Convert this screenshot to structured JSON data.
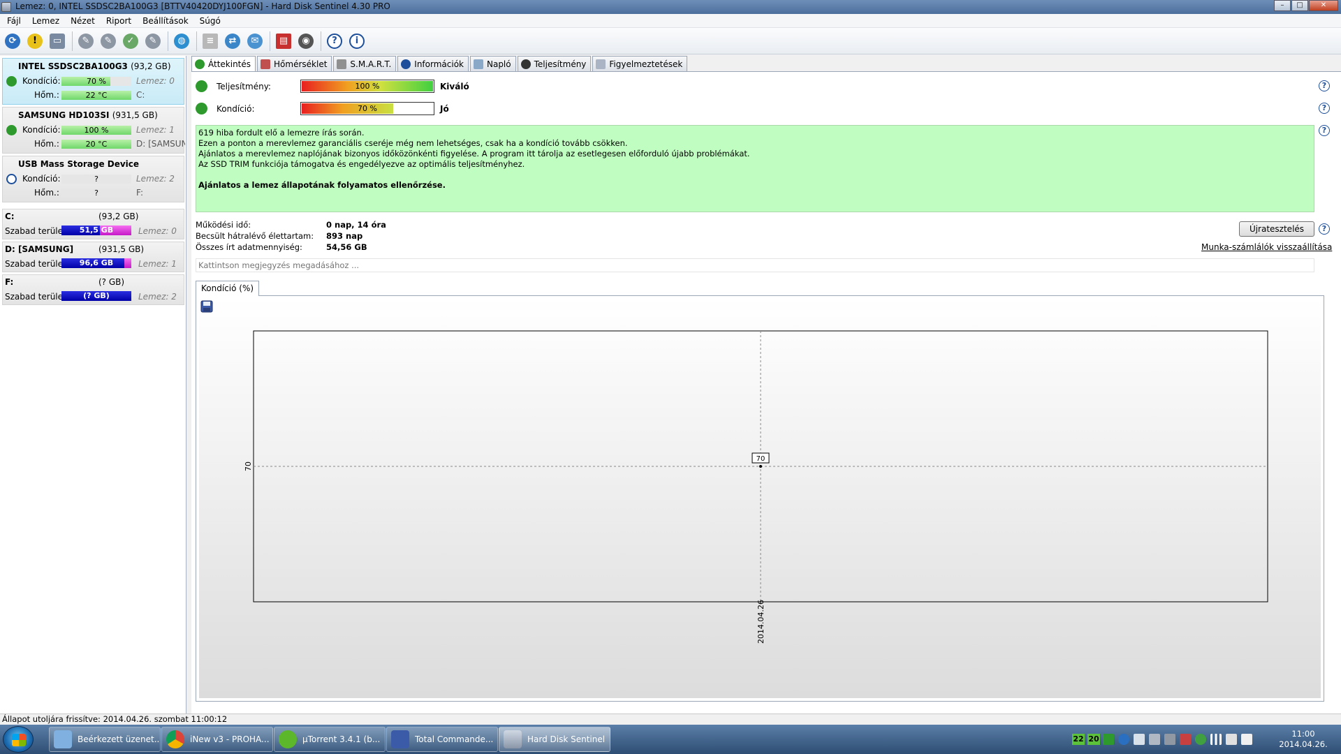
{
  "window": {
    "title": "Lemez: 0, INTEL SSDSC2BA100G3 [BTTV40420DYJ100FGN]  -  Hard Disk Sentinel 4.30 PRO"
  },
  "menu": [
    "Fájl",
    "Lemez",
    "Nézet",
    "Riport",
    "Beállítások",
    "Súgó"
  ],
  "disks": [
    {
      "name": "INTEL SSDSC2BA100G3",
      "size": "(93,2 GB)",
      "health_label": "Kondíció:",
      "health": "70 %",
      "health_fraction": 0.7,
      "temp_label": "Hőm.:",
      "temp": "22 °C",
      "disk_no": "Lemez: 0",
      "drive": "C:",
      "status": "ok"
    },
    {
      "name": "SAMSUNG HD103SI",
      "size": "(931,5 GB)",
      "health_label": "Kondíció:",
      "health": "100 %",
      "health_fraction": 1.0,
      "temp_label": "Hőm.:",
      "temp": "20 °C",
      "disk_no": "Lemez: 1",
      "drive": "D: [SAMSUNG]",
      "status": "ok"
    },
    {
      "name": "USB Mass Storage Device",
      "size": "",
      "health_label": "Kondíció:",
      "health": "?",
      "health_fraction": 0,
      "temp_label": "Hőm.:",
      "temp": "?",
      "disk_no": "Lemez: 2",
      "drive": "F:",
      "status": "unknown"
    }
  ],
  "volumes": [
    {
      "name": "C:",
      "size": "(93,2 GB)",
      "free_label": "Szabad terület",
      "free": "51,5 GB",
      "used_fraction": 0.45,
      "disk_no": "Lemez: 0"
    },
    {
      "name": "D: [SAMSUNG]",
      "size": "(931,5 GB)",
      "free_label": "Szabad terület",
      "free": "96,6 GB",
      "used_fraction": 0.1,
      "disk_no": "Lemez: 1"
    },
    {
      "name": "F:",
      "size": "(? GB)",
      "free_label": "Szabad terület",
      "free": "(? GB)",
      "used_fraction": 0,
      "disk_no": "Lemez: 2"
    }
  ],
  "tabs": [
    "Áttekintés",
    "Hőmérséklet",
    "S.M.A.R.T.",
    "Információk",
    "Napló",
    "Teljesítmény",
    "Figyelmeztetések"
  ],
  "overview": {
    "performance": {
      "label": "Teljesítmény:",
      "value": "100 %",
      "fraction": 1.0,
      "rating": "Kiváló"
    },
    "health": {
      "label": "Kondíció:",
      "value": "70 %",
      "fraction": 0.7,
      "rating": "Jó"
    },
    "info_lines": [
      "619 hiba fordult elő a lemezre írás során.",
      "Ezen a ponton a merevlemez garanciális cseréje még nem lehetséges, csak ha a kondíció tovább csökken.",
      "Ajánlatos a merevlemez naplójának bizonyos időközönkénti figyelése. A program itt tárolja az esetlegesen előforduló újabb problémákat.",
      "Az SSD TRIM funkciója támogatva és engedélyezve az optimális teljesítményhez."
    ],
    "info_strong": "Ajánlatos a lemez állapotának folyamatos ellenőrzése.",
    "uptime_label": "Működési idő:",
    "uptime": "0 nap, 14 óra",
    "lifetime_label": "Becsült hátralévő élettartam:",
    "lifetime": "893 nap",
    "written_label": "Összes írt adatmennyiség:",
    "written": "54,56 GB",
    "retest_label": "Újratesztelés",
    "reset_link": "Munka-számlálók visszaállítása",
    "note_placeholder": "Kattintson megjegyzés megadásához ..."
  },
  "chart_tab": "Kondíció  (%)",
  "chart_data": {
    "type": "line",
    "x": [
      "2014.04.26"
    ],
    "series": [
      {
        "values": [
          70
        ]
      }
    ],
    "yticks": [
      70
    ],
    "data_labels": [
      "70"
    ],
    "grid": true
  },
  "statusbar": "Állapot utoljára frissítve: 2014.04.26. szombat 11:00:12",
  "taskbar": {
    "tasks": [
      "Beérkezett üzenet...",
      "iNew v3 - PROHA...",
      "µTorrent 3.4.1  (b...",
      "Total Commande...",
      "Hard Disk Sentinel"
    ],
    "tray_numbers": [
      "22",
      "20"
    ],
    "time": "11:00",
    "date": "2014.04.26."
  },
  "colors": {
    "ok": "#2e9a2e",
    "accent": "#1d4f9a",
    "info_bg": "#c0fdc0"
  }
}
